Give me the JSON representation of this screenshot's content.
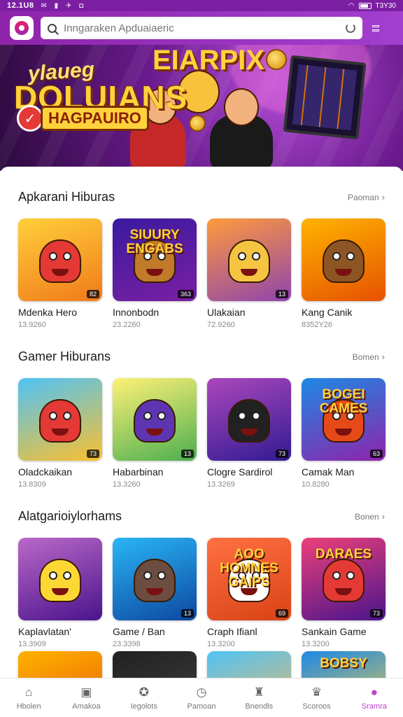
{
  "status_bar": {
    "time": "12.1U8",
    "right_text": "T3Y30"
  },
  "search": {
    "placeholder": "Inngaraken Apduaiaeric"
  },
  "banner": {
    "subtitle": "ylaueg",
    "title": "DOLUIANS",
    "title_right": "EIARPIX",
    "tag": "HAGPAUIRO"
  },
  "sections": [
    {
      "title": "Apkarani Hiburas",
      "see_more": "Paoman",
      "items": [
        {
          "name": "Mdenka Hero",
          "meta": "13.9260",
          "badge": "82",
          "thumb_title": "",
          "colors": [
            "#ffcf3a",
            "#f07a1a"
          ],
          "figure": "#e53935"
        },
        {
          "name": "Innonbodn",
          "meta": "23.2260",
          "badge": "363",
          "thumb_title": "SIUURY ENGABS",
          "colors": [
            "#3a1aa0",
            "#7b1fa2"
          ],
          "figure": "#c07a2a"
        },
        {
          "name": "Ulakaian",
          "meta": "72.9260",
          "badge": "13",
          "thumb_title": "",
          "colors": [
            "#ff9a3c",
            "#8e44ad"
          ],
          "figure": "#f5c542"
        },
        {
          "name": "Kang Canik",
          "meta": "8352Y26",
          "badge": "",
          "thumb_title": "",
          "colors": [
            "#ffb300",
            "#e65100"
          ],
          "figure": "#8d5524"
        }
      ]
    },
    {
      "title": "Gamer Hiburans",
      "see_more": "Bomen",
      "items": [
        {
          "name": "Oladckaikan",
          "meta": "13.8309",
          "badge": "73",
          "thumb_title": "",
          "colors": [
            "#4fc3f7",
            "#fbc02d"
          ],
          "figure": "#e53935"
        },
        {
          "name": "Habarbinan",
          "meta": "13.3260",
          "badge": "13",
          "thumb_title": "",
          "colors": [
            "#fff176",
            "#4caf50"
          ],
          "figure": "#5e35b1"
        },
        {
          "name": "Clogre Sardirol",
          "meta": "13.3269",
          "badge": "73",
          "thumb_title": "",
          "colors": [
            "#ab47bc",
            "#311b92"
          ],
          "figure": "#212121"
        },
        {
          "name": "Camak Man",
          "meta": "10.8280",
          "badge": "63",
          "thumb_title": "BOGEI CAMES",
          "colors": [
            "#1e88e5",
            "#8e24aa"
          ],
          "figure": "#e64a19"
        }
      ]
    },
    {
      "title": "Alatgarioiylorhams",
      "see_more": "Bonen",
      "items": [
        {
          "name": "Kaplavlatan'",
          "meta": "13.3909",
          "badge": "",
          "thumb_title": "",
          "colors": [
            "#ba68c8",
            "#4a148c"
          ],
          "figure": "#fdd835"
        },
        {
          "name": "Game / Ban",
          "meta": "23.3398",
          "badge": "13",
          "thumb_title": "",
          "colors": [
            "#29b6f6",
            "#0d47a1"
          ],
          "figure": "#6d4c41"
        },
        {
          "name": "Craph Ifianl",
          "meta": "13.3200",
          "badge": "69",
          "thumb_title": "AOO HOMNES GAIPS",
          "colors": [
            "#ff7043",
            "#d84315"
          ],
          "figure": "#ffffff"
        },
        {
          "name": "Sankain Game",
          "meta": "13.3200",
          "badge": "73",
          "thumb_title": "DARAES",
          "colors": [
            "#ec407a",
            "#4a148c"
          ],
          "figure": "#e53935"
        }
      ]
    }
  ],
  "peek_items": [
    {
      "colors": [
        "#ffb300",
        "#e65100"
      ]
    },
    {
      "colors": [
        "#212121",
        "#424242"
      ]
    },
    {
      "colors": [
        "#4fc3f7",
        "#ffb74d"
      ]
    },
    {
      "colors": [
        "#1e88e5",
        "#ffd23c"
      ],
      "title": "BOBSY"
    }
  ],
  "bottom_nav": [
    {
      "label": "Hbolen",
      "icon": "home-icon",
      "glyph": "⌂",
      "active": false
    },
    {
      "label": "Amakoa",
      "icon": "store-icon",
      "glyph": "▣",
      "active": false
    },
    {
      "label": "Iegolots",
      "icon": "controller-icon",
      "glyph": "✪",
      "active": false
    },
    {
      "label": "Pamoan",
      "icon": "clock-icon",
      "glyph": "◷",
      "active": false
    },
    {
      "label": "Bnendls",
      "icon": "gift-icon",
      "glyph": "♜",
      "active": false
    },
    {
      "label": "Scoroos",
      "icon": "trophy-icon",
      "glyph": "♛",
      "active": false
    },
    {
      "label": "Sramra",
      "icon": "profile-icon",
      "glyph": "●",
      "active": true
    }
  ]
}
